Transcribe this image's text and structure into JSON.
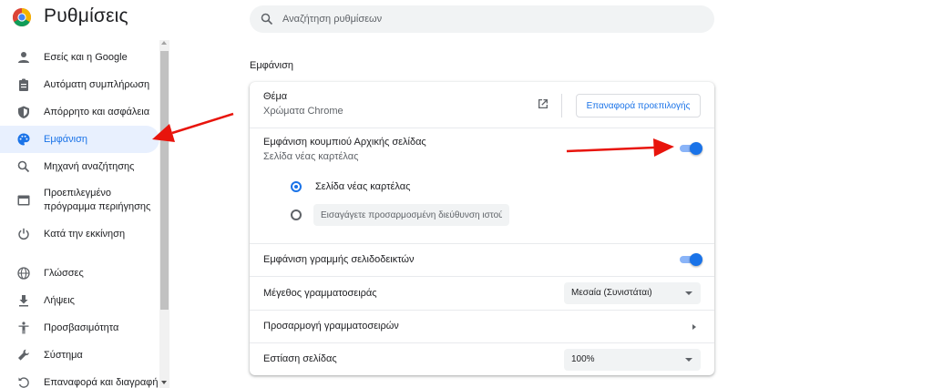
{
  "header": {
    "title": "Ρυθμίσεις",
    "logo_icon": "chrome-logo-icon",
    "search_placeholder": "Αναζήτηση ρυθμίσεων"
  },
  "sidebar": {
    "items": [
      {
        "label": "Εσείς και η Google",
        "icon": "person-icon"
      },
      {
        "label": "Αυτόματη συμπλήρωση",
        "icon": "clipboard-icon"
      },
      {
        "label": "Απόρρητο και ασφάλεια",
        "icon": "shield-icon"
      },
      {
        "label": "Εμφάνιση",
        "icon": "palette-icon",
        "active": true
      },
      {
        "label": "Μηχανή αναζήτησης",
        "icon": "search-icon"
      },
      {
        "label": "Προεπιλεγμένο πρόγραμμα περιήγησης",
        "icon": "browser-icon"
      },
      {
        "label": "Κατά την εκκίνηση",
        "icon": "power-icon"
      },
      {
        "label": "Γλώσσες",
        "icon": "globe-icon"
      },
      {
        "label": "Λήψεις",
        "icon": "download-icon"
      },
      {
        "label": "Προσβασιμότητα",
        "icon": "accessibility-icon"
      },
      {
        "label": "Σύστημα",
        "icon": "wrench-icon"
      },
      {
        "label": "Επαναφορά και διαγραφή",
        "icon": "reset-icon"
      }
    ]
  },
  "appearance": {
    "section_title": "Εμφάνιση",
    "theme": {
      "title": "Θέμα",
      "subtitle": "Χρώματα Chrome",
      "open_icon": "open-in-new-icon",
      "reset_button": "Επαναφορά προεπιλογής"
    },
    "home_button": {
      "title": "Εμφάνιση κουμπιού Αρχικής σελίδας",
      "subtitle": "Σελίδα νέας καρτέλας",
      "enabled": true,
      "option_new_tab": "Σελίδα νέας καρτέλας",
      "option_custom_placeholder": "Εισαγάγετε προσαρμοσμένη διεύθυνση ιστού",
      "selected": "new_tab"
    },
    "bookmarks_bar": {
      "title": "Εμφάνιση γραμμής σελιδοδεικτών",
      "enabled": true
    },
    "font_size": {
      "title": "Μέγεθος γραμματοσειράς",
      "value": "Μεσαία (Συνιστάται)"
    },
    "customize_fonts": {
      "title": "Προσαρμογή γραμματοσειρών"
    },
    "page_zoom": {
      "title": "Εστίαση σελίδας",
      "value": "100%"
    }
  },
  "colors": {
    "accent": "#1a73e8",
    "active_nav_bg": "#e8f0fe",
    "annotation_arrow": "#e8140c"
  }
}
